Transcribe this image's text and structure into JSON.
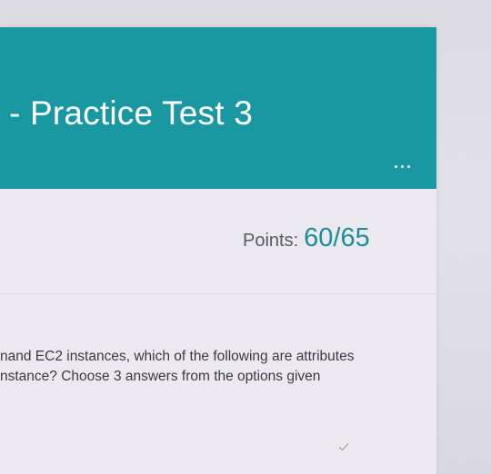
{
  "header": {
    "title": "- Practice Test 3",
    "more_icon": "more-horizontal-icon",
    "accent_color": "#1a98a2"
  },
  "score": {
    "label": "Points:",
    "value": "60/65"
  },
  "question": {
    "line1": "nand EC2 instances, which of the following are attributes",
    "line2": "nstance? Choose 3 answers from the options given"
  },
  "icons": {
    "check": "checkmark-icon"
  }
}
